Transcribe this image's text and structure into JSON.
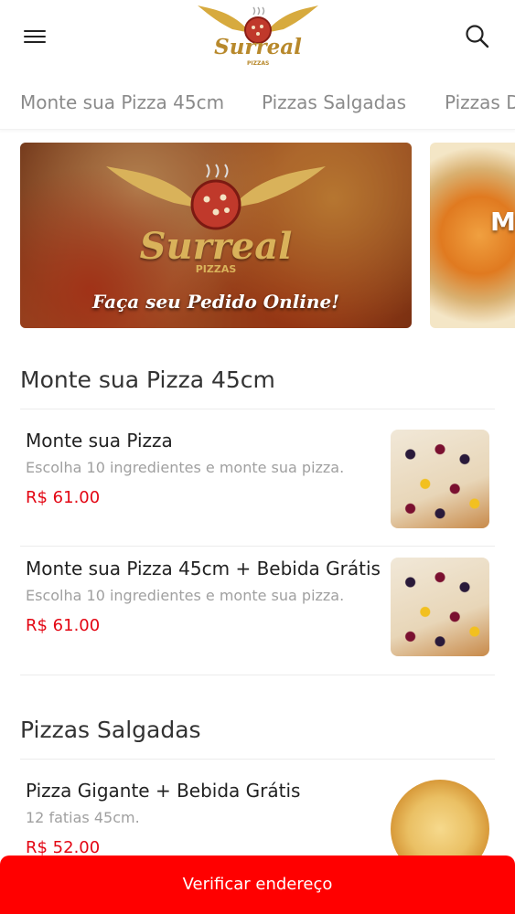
{
  "header": {
    "menu_icon": "hamburger-menu-icon",
    "search_icon": "search-icon",
    "logo": {
      "name": "Surreal",
      "sub": "PIZZAS"
    }
  },
  "tabs": [
    {
      "label": "Monte sua Pizza 45cm"
    },
    {
      "label": "Pizzas Salgadas"
    },
    {
      "label": "Pizzas D"
    }
  ],
  "banners": [
    {
      "logo_name": "Surreal",
      "logo_sub": "PIZZAS",
      "caption": "Faça seu Pedido Online!"
    },
    {
      "partial_text": "M"
    }
  ],
  "sections": [
    {
      "title": "Monte sua Pizza 45cm",
      "items": [
        {
          "name": "Monte sua Pizza",
          "description": "Escolha 10 ingredientes e monte sua pizza.",
          "price": "R$ 61.00"
        },
        {
          "name": "Monte sua Pizza 45cm + Bebida Grátis",
          "description": "Escolha 10 ingredientes e monte sua pizza.",
          "price": "R$ 61.00"
        }
      ]
    },
    {
      "title": "Pizzas Salgadas",
      "items": [
        {
          "name": "Pizza Gigante + Bebida Grátis",
          "description": "12 fatias 45cm.",
          "price": "R$ 52.00"
        }
      ]
    }
  ],
  "cta": {
    "label": "Verificar endereço"
  },
  "colors": {
    "accent": "#ff0000",
    "price": "#e30613",
    "logo_gold": "#b8892c"
  }
}
